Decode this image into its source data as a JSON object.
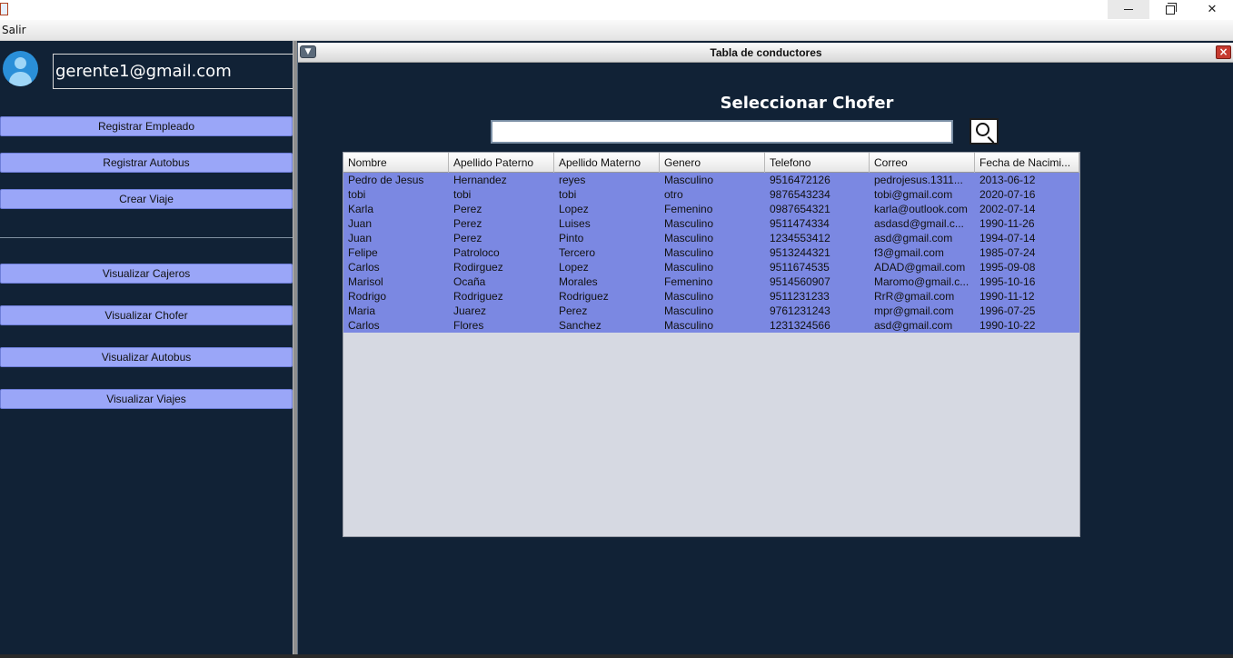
{
  "window": {
    "minimize_icon": "minimize-icon",
    "maximize_icon": "restore-icon",
    "close_icon": "close-icon"
  },
  "menubar": {
    "items": [
      "Salir"
    ]
  },
  "sidebar": {
    "user_email": "gerente1@gmail.com",
    "buttons": [
      "Registrar Empleado",
      "Registrar Autobus",
      "Crear Viaje",
      "Visualizar Cajeros",
      "Visualizar Chofer",
      "Visualizar Autobus",
      "Visualizar Viajes"
    ]
  },
  "frame": {
    "title": "Tabla de conductores",
    "heading": "Seleccionar Chofer",
    "search_value": "",
    "close_label": "×"
  },
  "table": {
    "columns": [
      "Nombre",
      "Apellido Paterno",
      "Apellido Materno",
      "Genero",
      "Telefono",
      "Correo",
      "Fecha de Nacimi..."
    ],
    "rows": [
      [
        "Pedro de Jesus",
        "Hernandez",
        "reyes",
        "Masculino",
        "9516472126",
        "pedrojesus.1311...",
        "2013-06-12"
      ],
      [
        "tobi",
        "tobi",
        "tobi",
        "otro",
        "9876543234",
        "tobi@gmail.com",
        "2020-07-16"
      ],
      [
        "Karla",
        "Perez",
        "Lopez",
        "Femenino",
        "0987654321",
        "karla@outlook.com",
        "2002-07-14"
      ],
      [
        "Juan",
        "Perez",
        "Luises",
        "Masculino",
        "9511474334",
        "asdasd@gmail.c...",
        "1990-11-26"
      ],
      [
        "Juan",
        "Perez",
        "Pinto",
        "Masculino",
        "1234553412",
        "asd@gmail.com",
        "1994-07-14"
      ],
      [
        "Felipe",
        "Patroloco",
        "Tercero",
        "Masculino",
        "9513244321",
        "f3@gmail.com",
        "1985-07-24"
      ],
      [
        "Carlos",
        "Rodirguez",
        "Lopez",
        "Masculino",
        "9511674535",
        "ADAD@gmail.com",
        "1995-09-08"
      ],
      [
        "Marisol",
        "Ocaña",
        "Morales",
        "Femenino",
        "9514560907",
        "Maromo@gmail.c...",
        "1995-10-16"
      ],
      [
        "Rodrigo",
        "Rodriguez",
        "Rodriguez",
        "Masculino",
        "9511231233",
        "RrR@gmail.com",
        "1990-11-12"
      ],
      [
        "Maria",
        "Juarez",
        "Perez",
        "Masculino",
        "9761231243",
        "mpr@gmail.com",
        "1996-07-25"
      ],
      [
        "Carlos",
        "Flores",
        "Sanchez",
        "Masculino",
        "1231324566",
        "asd@gmail.com",
        "1990-10-22"
      ]
    ]
  },
  "colors": {
    "background": "#112236",
    "button": "#9aa6f8",
    "row_selected": "#7b88e2",
    "table_empty": "#d6d9e2"
  }
}
